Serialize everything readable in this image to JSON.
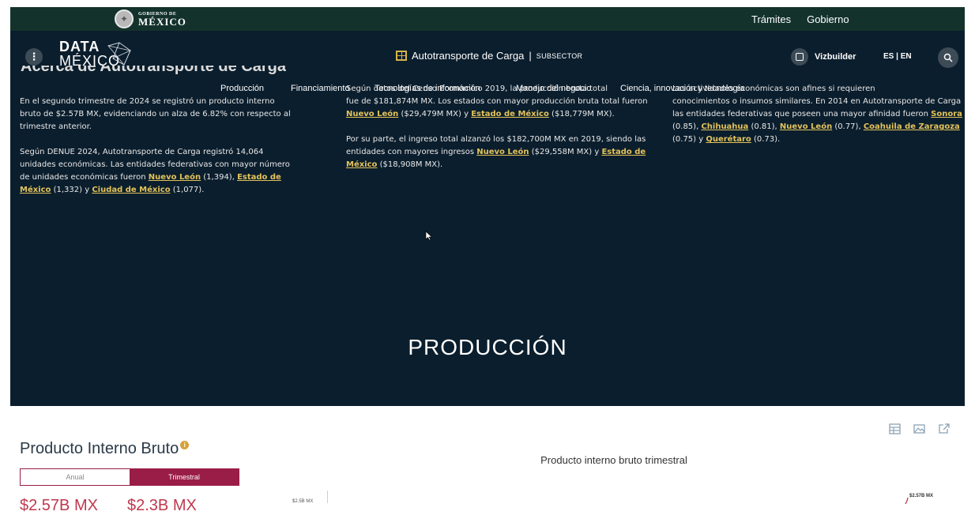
{
  "gov_bar": {
    "logo_small": "GOBIERNO DE",
    "logo_big": "MÉXICO",
    "links": [
      "Trámites",
      "Gobierno"
    ]
  },
  "nav": {
    "logo_line1": "DATA",
    "logo_line2": "MÉXICO",
    "subsector_title": "Autotransporte de Carga",
    "subsector_sep": "|",
    "subsector_kind": "SUBSECTOR",
    "vizbuilder": "Vizbuilder",
    "lang": "ES | EN"
  },
  "about": {
    "heading": "Acerca de Autotransporte de Carga",
    "tabs": [
      "Producción",
      "Financiamiento",
      "Tecnologías de información",
      "Manejo del negocio",
      "Ciencia, innovación y tecnología"
    ],
    "col1": {
      "p1": "En el segundo trimestre de 2024 se registró un producto interno bruto de $2.57B MX, evidenciando un alza de 6.82% con respecto al trimestre anterior.",
      "p2_a": "Según DENUE 2024, Autotransporte de Carga registró 14,064 unidades económicas. Las entidades federativas con mayor número de unidades económicas fueron ",
      "link1": "Nuevo León",
      "p2_b": " (1,394), ",
      "link2": "Estado de México",
      "p2_c": " (1,332) y ",
      "link3": "Ciudad de México",
      "p2_d": " (1,077)."
    },
    "col2": {
      "lead": "Según datos del Censo Económico 2019, la producción bruta total",
      "p1_a": "fue de $181,874M MX. Los estados con mayor producción bruta total fueron ",
      "link1": "Nuevo León",
      "p1_b": " ($29,479M MX) y ",
      "link2": "Estado de México",
      "p1_c": " ($18,779M MX).",
      "p2_a": "Por su parte, el ingreso total alzanzó los $182,700M MX en 2019, siendo las entidades con mayores ingresos ",
      "link3": "Nuevo León",
      "p2_b": " ($29,558M MX) y ",
      "link4": "Estado de México",
      "p2_c": " ($18,908M MX)."
    },
    "col3": {
      "lead": "Las actividades económicas son afines si requieren",
      "p1_a": "conocimientos o insumos similares. En 2014 en Autotransporte de Carga las entidades federativas que poseen una mayor afinidad fueron ",
      "link1": "Sonora",
      "p1_b": " (0.85), ",
      "link2": "Chihuahua",
      "p1_c": " (0.81), ",
      "link3": "Nuevo León",
      "p1_d": " (0.77), ",
      "link4": "Coahuila de Zaragoza",
      "p1_e": " (0.75) y ",
      "link5": "Querétaro",
      "p1_f": " (0.73)."
    }
  },
  "section": {
    "title": "PRODUCCIÓN"
  },
  "pib": {
    "title": "Producto Interno Bruto",
    "info": "i",
    "toggle": [
      "Anual",
      "Trimestral"
    ],
    "active_toggle": "Trimestral",
    "value1": "$2.57B MX",
    "value2": "$2.3B MX",
    "axis_tick": "$2.5B MX",
    "chart_title": "Producto interno bruto trimestral",
    "end_label": "$2.57B MX"
  },
  "colors": {
    "gov_green": "#13322b",
    "dark_bg": "#0b1e2d",
    "link_gold": "#e3c35a",
    "accent_wine": "#9a1d47",
    "value_red": "#c0384e"
  }
}
